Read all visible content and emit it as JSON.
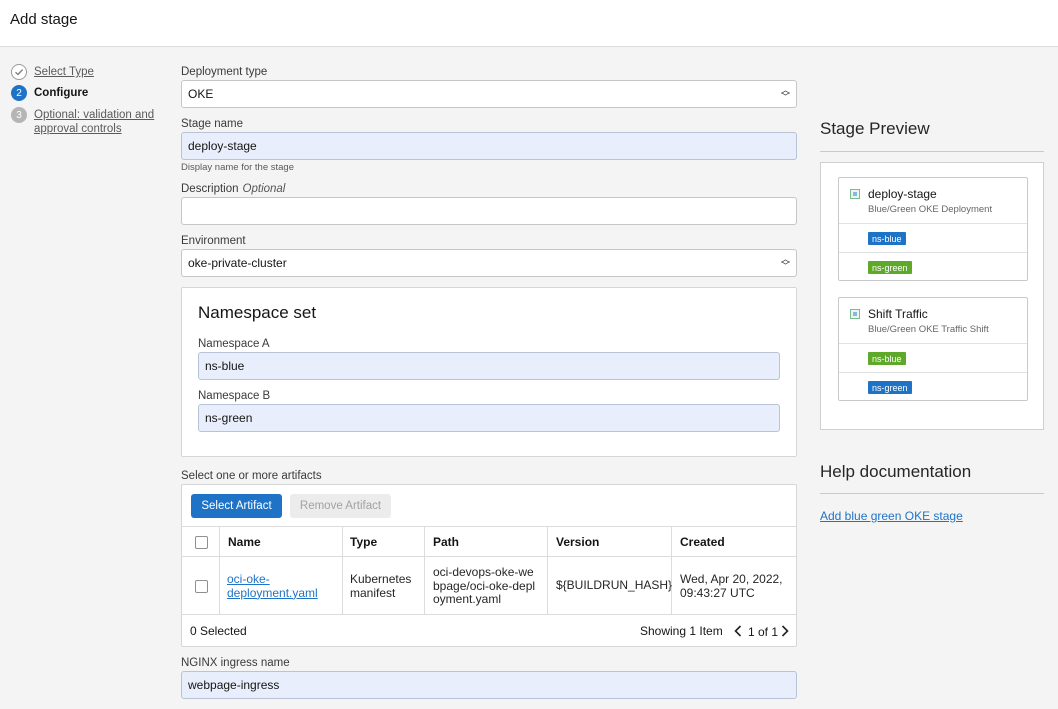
{
  "header": {
    "title": "Add stage"
  },
  "steps": [
    {
      "number": "✓",
      "label": "Select Type"
    },
    {
      "number": "2",
      "label": "Configure"
    },
    {
      "number": "3",
      "label": "Optional: validation and approval controls"
    }
  ],
  "form": {
    "deployment_type": {
      "label": "Deployment type",
      "value": "OKE"
    },
    "stage_name": {
      "label": "Stage name",
      "value": "deploy-stage",
      "hint": "Display name for the stage"
    },
    "description": {
      "label": "Description",
      "optional": "Optional",
      "value": ""
    },
    "environment": {
      "label": "Environment",
      "value": "oke-private-cluster"
    },
    "namespace_set": {
      "title": "Namespace set",
      "a_label": "Namespace A",
      "a_value": "ns-blue",
      "b_label": "Namespace B",
      "b_value": "ns-green"
    },
    "artifacts": {
      "label": "Select one or more artifacts",
      "select_button": "Select Artifact",
      "remove_button": "Remove Artifact",
      "columns": [
        "Name",
        "Type",
        "Path",
        "Version",
        "Created"
      ],
      "rows": [
        {
          "name": "oci-oke-deployment.yaml",
          "type": "Kubernetes manifest",
          "path": "oci-devops-oke-webpage/oci-oke-deployment.yaml",
          "version": "${BUILDRUN_HASH}",
          "created": "Wed, Apr 20, 2022, 09:43:27 UTC"
        }
      ],
      "selected_count": "0 Selected",
      "showing": "Showing 1 Item",
      "page": "1 of 1"
    },
    "nginx": {
      "label": "NGINX ingress name",
      "value": "webpage-ingress"
    }
  },
  "preview": {
    "title": "Stage Preview",
    "cards": [
      {
        "title": "deploy-stage",
        "subtitle": "Blue/Green OKE Deployment",
        "badge1": "ns-blue",
        "badge2": "ns-green"
      },
      {
        "title": "Shift Traffic",
        "subtitle": "Blue/Green OKE Traffic Shift",
        "badge1": "ns-blue",
        "badge2": "ns-green"
      }
    ]
  },
  "help": {
    "title": "Help documentation",
    "link": "Add blue green OKE stage"
  },
  "colors": {
    "accent": "#1f73c7",
    "green": "#5ea92a"
  }
}
